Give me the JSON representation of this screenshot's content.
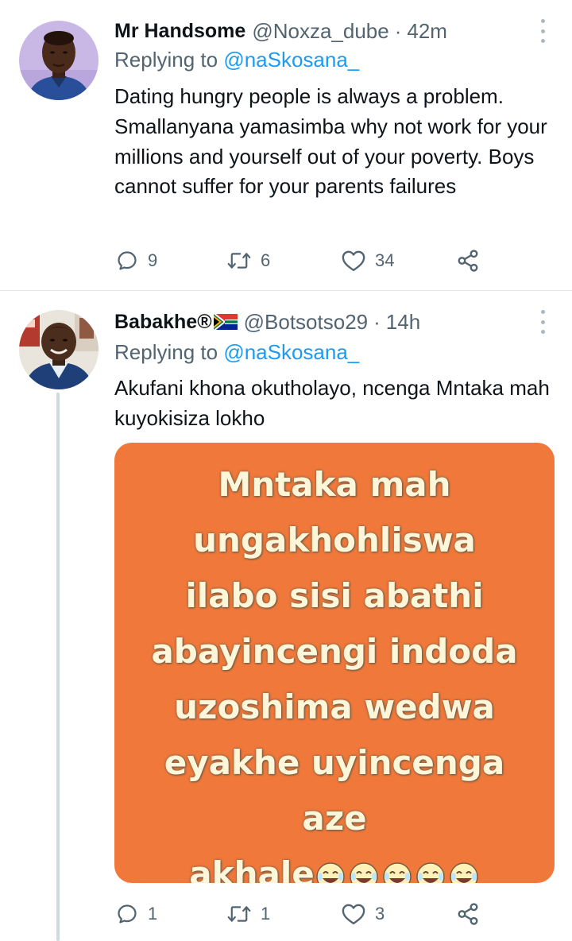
{
  "tweets": [
    {
      "author_name": "Mr Handsome",
      "handle": "@Noxza_dube",
      "separator": "·",
      "time": "42m",
      "replying_prefix": "Replying to",
      "replying_to": "@naSkosana_",
      "text": "Dating hungry people is always a problem. Smallanyana yamasimba why not work for your millions and yourself out of your poverty. Boys cannot suffer for your parents failures",
      "replies": "9",
      "retweets": "6",
      "likes": "34"
    },
    {
      "author_name": "Babakhe®",
      "handle": "@Botsotso29",
      "separator": "·",
      "time": "14h",
      "replying_prefix": "Replying to",
      "replying_to": "@naSkosana_",
      "text": "Akufani khona okutholayo, ncenga Mntaka mah kuyokisiza lokho",
      "media_lines": [
        "Mntaka mah",
        "ungakhohliswa",
        "ilabo sisi abathi",
        "abayincengi indoda",
        "uzoshima wedwa",
        "eyakhe uyincenga",
        "aze",
        "akhale"
      ],
      "replies": "1",
      "retweets": "1",
      "likes": "3"
    }
  ],
  "colors": {
    "text_primary": "#0f1419",
    "text_secondary": "#536471",
    "link": "#1d9bf0",
    "media_background": "#f0783a",
    "media_text": "#fdf6d8",
    "thread_line": "#cfd9de"
  },
  "icons": {
    "reply": "reply-icon",
    "retweet": "retweet-icon",
    "like": "heart-icon",
    "share": "share-icon",
    "more": "more-icon",
    "flag": "south-africa-flag-icon",
    "emoji": "laughing-tears-emoji-icon"
  }
}
